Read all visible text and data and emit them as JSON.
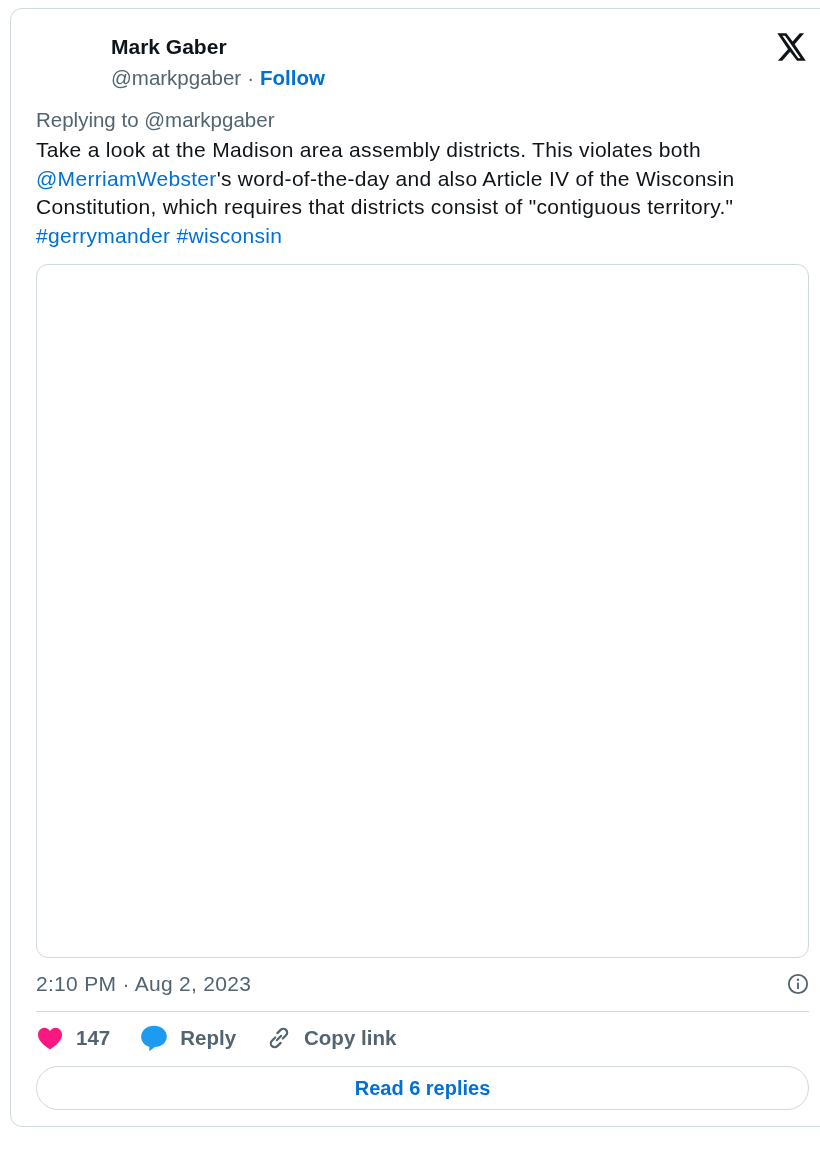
{
  "author": {
    "name": "Mark Gaber",
    "handle": "@markpgaber",
    "separator": "·",
    "follow": "Follow"
  },
  "reply_context": "Replying to @markpgaber",
  "text": [
    {
      "kind": "text",
      "text": "Take a look at the Madison area assembly districts. This violates both "
    },
    {
      "kind": "link",
      "text": "@MerriamWebster"
    },
    {
      "kind": "text",
      "text": "'s word-of-the-day and also Article IV of the Wisconsin Constitution, which requires that districts consist of \"contiguous territory.\" "
    },
    {
      "kind": "link",
      "text": "#gerrymander "
    },
    {
      "kind": "link",
      "text": "#wisconsin"
    }
  ],
  "timestamp": "2:10 PM · Aug 2, 2023",
  "actions": [
    {
      "kind": "like",
      "label": "147"
    },
    {
      "kind": "reply",
      "label": "Reply"
    },
    {
      "kind": "copy",
      "label": "Copy link"
    }
  ],
  "read_replies": "Read 6 replies"
}
